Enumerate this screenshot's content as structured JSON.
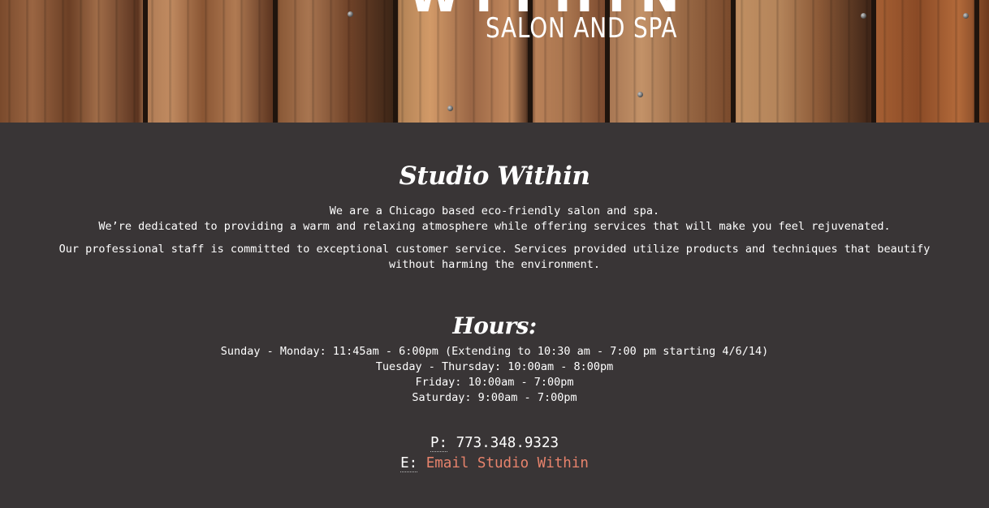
{
  "header": {
    "logo_top": "WITHIN",
    "logo_sub": "SALON AND SPA"
  },
  "about": {
    "title": "Studio Within",
    "line1": "We are a Chicago based eco-friendly salon and spa.",
    "line2": "We’re dedicated to providing a warm and relaxing atmosphere while offering services that will make you feel rejuvenated.",
    "line3": "Our professional staff is committed to exceptional customer service. Services provided utilize products and techniques that beautify",
    "line4": "without harming the environment."
  },
  "hours": {
    "title": "Hours:",
    "rows": [
      "Sunday - Monday: 11:45am - 6:00pm (Extending to 10:30 am - 7:00 pm starting 4/6/14)",
      "Tuesday - Thursday: 10:00am - 8:00pm",
      "Friday: 10:00am - 7:00pm",
      "Saturday: 9:00am - 7:00pm"
    ]
  },
  "contact": {
    "phone_label": "P:",
    "phone": "773.348.9323",
    "email_label": "E:",
    "email_link": "Email Studio Within",
    "link_color": "#e8836c"
  }
}
